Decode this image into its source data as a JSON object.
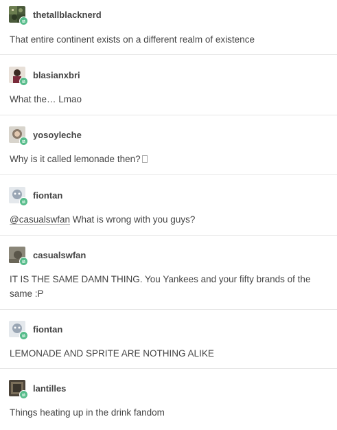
{
  "posts": [
    {
      "username": "thetallblacknerd",
      "text": "That entire continent exists on a different realm of existence"
    },
    {
      "username": "blasianxbri",
      "text": "What the… Lmao"
    },
    {
      "username": "yosoyleche",
      "text": "Why is it called lemonade then?"
    },
    {
      "username": "fiontan",
      "mention": "@casualswfan",
      "text": " What is wrong with you guys?"
    },
    {
      "username": "casualswfan",
      "text": "IT IS THE SAME DAMN THING. You Yankees and your fifty brands of the same :P"
    },
    {
      "username": "fiontan",
      "text": "LEMONADE AND SPRITE ARE NOTHING ALIKE"
    },
    {
      "username": "lantilles",
      "text": "Things heating up in the drink fandom"
    }
  ],
  "colors": {
    "reblog_badge": "#56bc8a",
    "text": "#444444",
    "divider": "#e6e6e6"
  },
  "icons": {
    "reblog": "reblog-icon",
    "missing_glyph": "missing-glyph-icon"
  }
}
